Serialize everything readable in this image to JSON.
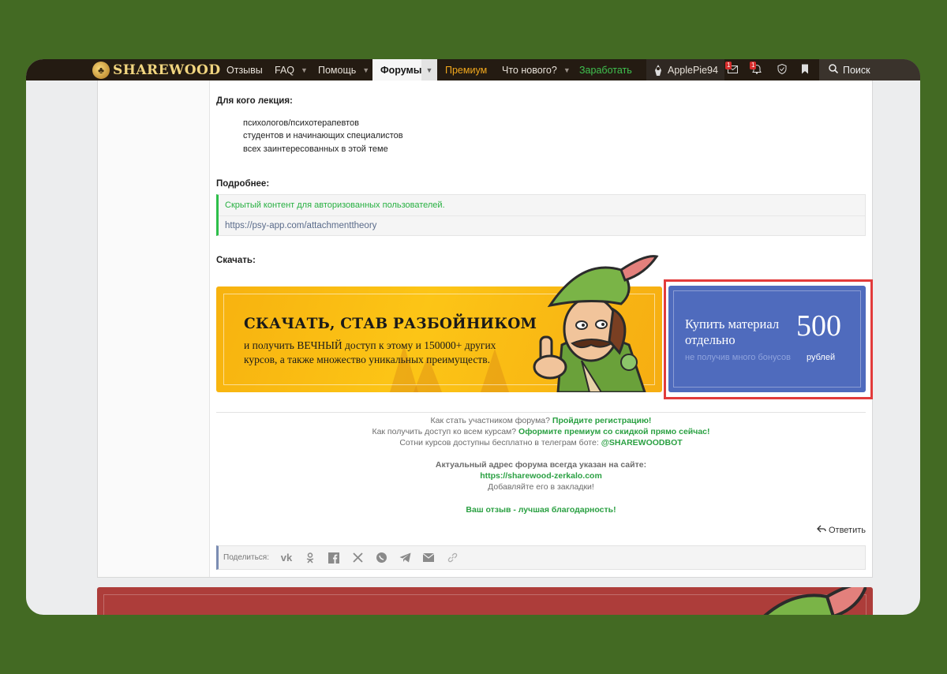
{
  "nav": {
    "logo_text": "SHAREWOOD",
    "items": [
      {
        "label": "Отзывы"
      },
      {
        "label": "FAQ"
      },
      {
        "label": "Помощь"
      },
      {
        "label": "Форумы"
      },
      {
        "label": "Премиум"
      },
      {
        "label": "Что нового?"
      },
      {
        "label": "Заработать"
      }
    ],
    "username": "ApplePie94",
    "messages_badge": "1",
    "alerts_badge": "1",
    "search_label": "Поиск",
    "colors": {
      "premium": "#f2a81d",
      "earn": "#3fc14f"
    }
  },
  "post": {
    "audience_heading": "Для кого лекция:",
    "audience": [
      "психологов/психотерапевтов",
      "студентов и начинающих специалистов",
      "всех заинтересованных в этой теме"
    ],
    "details_heading": "Подробнее:",
    "hidden_notice": "Скрытый контент для авторизованных пользователей.",
    "link": "https://psy-app.com/attachmenttheory",
    "download_heading": "Скачать:",
    "banner_title": "СКАЧАТЬ, СТАВ РАЗБОЙНИКОМ",
    "banner_text": "и получить ВЕЧНЫЙ доступ к этому и 150000+ других курсов, а также множество уникальных преимуществ.",
    "buy_title": "Купить материал отдельно",
    "buy_price": "500",
    "buy_subtitle": "не получив много бонусов",
    "buy_currency": "рублей"
  },
  "footer_info": {
    "line1_prefix": "Как стать участником форума?",
    "line1_link": "Пройдите регистрацию!",
    "line2_prefix": "Как получить доступ ко всем курсам?",
    "line2_link": "Оформите премиум со скидкой прямо сейчас!",
    "line3_prefix": "Сотни курсов доступны бесплатно в телеграм боте:",
    "line3_link": "@SHAREWOODBOT",
    "address_heading": "Актуальный адрес форума всегда указан на сайте:",
    "address_link": "https://sharewood-zerkalo.com",
    "bookmark_hint": "Добавляйте его в закладки!",
    "review_cta": "Ваш отзыв - лучшая благодарность!"
  },
  "actions": {
    "reply_label": "Ответить",
    "share_label": "Поделиться:",
    "share_icons": [
      "vk-icon",
      "odnoklassniki-icon",
      "facebook-icon",
      "x-icon",
      "whatsapp-icon",
      "telegram-icon",
      "email-icon",
      "link-icon"
    ]
  }
}
